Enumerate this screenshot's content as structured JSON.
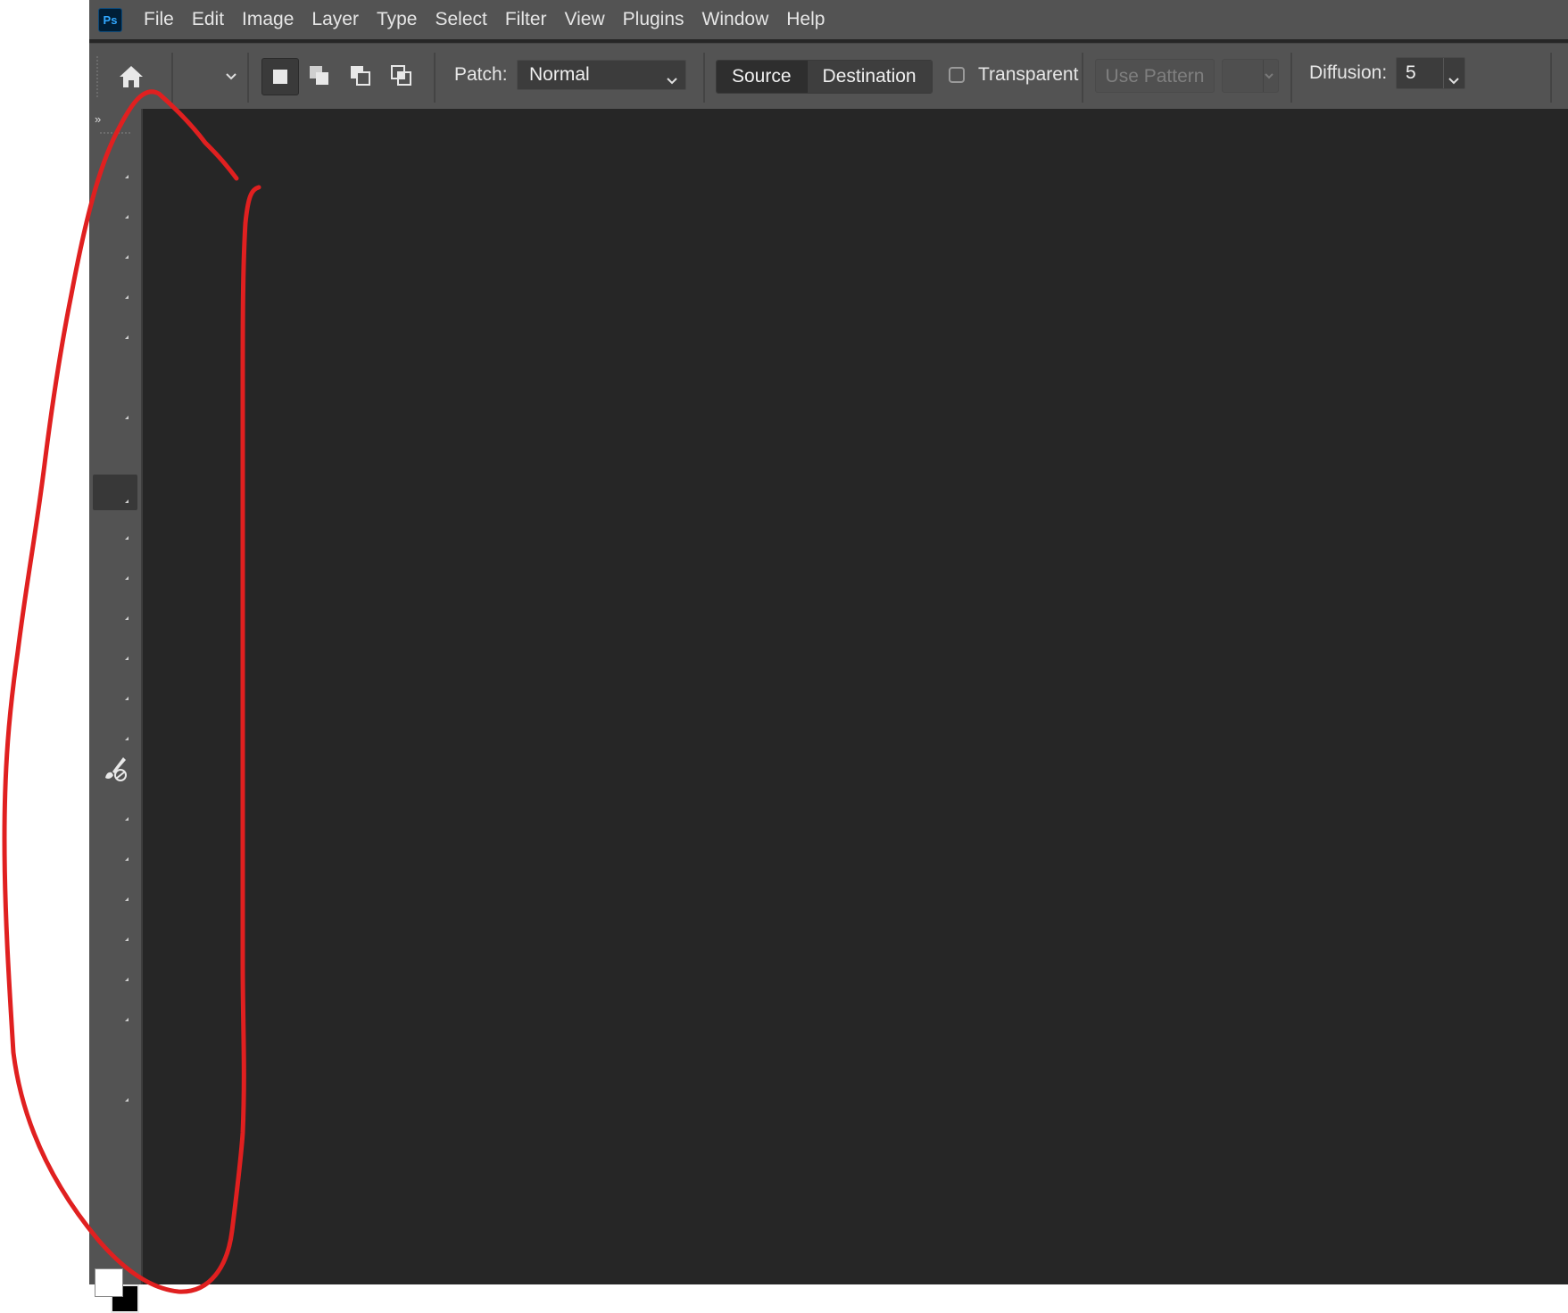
{
  "app": {
    "logo_text": "Ps"
  },
  "menu": [
    "File",
    "Edit",
    "Image",
    "Layer",
    "Type",
    "Select",
    "Filter",
    "View",
    "Plugins",
    "Window",
    "Help"
  ],
  "options": {
    "patch_label": "Patch:",
    "patch_mode": "Normal",
    "source_label": "Source",
    "destination_label": "Destination",
    "transparent_label": "Transparent",
    "transparent_checked": false,
    "use_pattern_label": "Use Pattern",
    "diffusion_label": "Diffusion:",
    "diffusion_value": "5"
  },
  "toolbar": {
    "collapse_label": "»"
  },
  "colors": {
    "foreground": "#ffffff",
    "background": "#000000",
    "annotation": "#e02020"
  }
}
